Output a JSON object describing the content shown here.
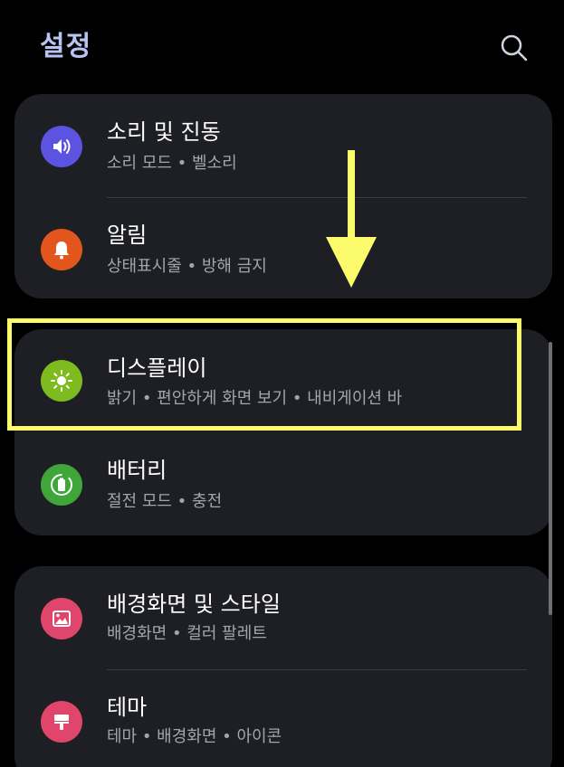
{
  "header": {
    "title": "설정"
  },
  "groups": [
    {
      "items": [
        {
          "title": "소리 및 진동",
          "subtitle": "소리 모드 • 벨소리",
          "icon": "speaker-icon",
          "icon_color": "#5c53e0"
        },
        {
          "title": "알림",
          "subtitle": "상태표시줄 • 방해 금지",
          "icon": "bell-icon",
          "icon_color": "#e2561e"
        }
      ]
    },
    {
      "items": [
        {
          "title": "디스플레이",
          "subtitle": "밝기 • 편안하게 화면 보기 • 내비게이션 바",
          "icon": "sun-icon",
          "icon_color": "#7dbb1e"
        },
        {
          "title": "배터리",
          "subtitle": "절전 모드 • 충전",
          "icon": "battery-icon",
          "icon_color": "#3fa63a"
        }
      ]
    },
    {
      "items": [
        {
          "title": "배경화면 및 스타일",
          "subtitle": "배경화면 • 컬러 팔레트",
          "icon": "wallpaper-icon",
          "icon_color": "#e0466c"
        },
        {
          "title": "테마",
          "subtitle": "테마 • 배경화면 • 아이콘",
          "icon": "paintbrush-icon",
          "icon_color": "#e0466c"
        }
      ]
    }
  ],
  "colors": {
    "title": "#b8c4f4",
    "card_background": "#1e1f24",
    "subtitle": "#a3a5ab",
    "annotation": "#fbfb6c"
  }
}
